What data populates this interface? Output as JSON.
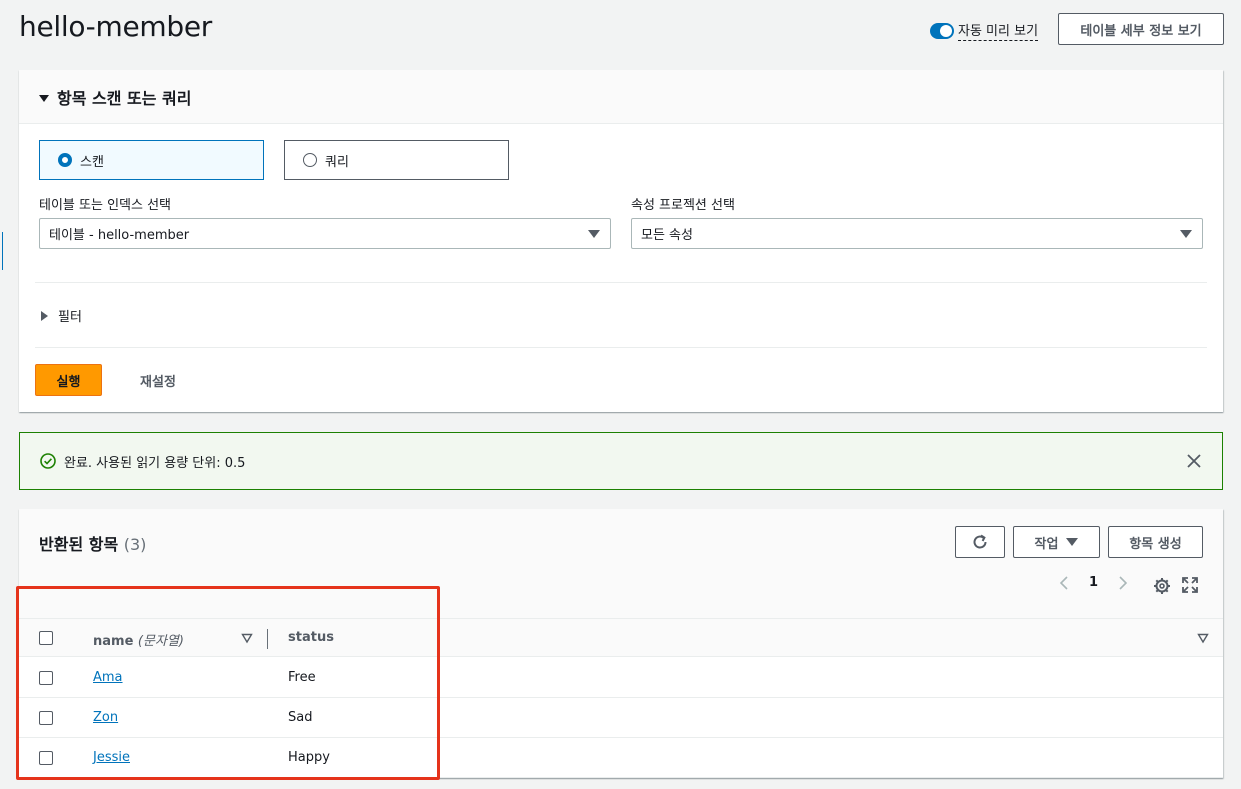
{
  "page": {
    "title": "hello-member",
    "auto_preview_label": "자동 미리 보기",
    "table_details_label": "테이블 세부 정보 보기"
  },
  "scan_panel": {
    "title": "항목 스캔 또는 쿼리",
    "modes": [
      {
        "label": "스캔",
        "selected": true
      },
      {
        "label": "쿼리",
        "selected": false
      }
    ],
    "table_select": {
      "label": "테이블 또는 인덱스 선택",
      "value": "테이블 - hello-member"
    },
    "attr_select": {
      "label": "속성 프로젝션 선택",
      "value": "모든 속성"
    },
    "filter_label": "필터",
    "run_label": "실행",
    "reset_label": "재설정"
  },
  "flash": {
    "message": "완료. 사용된 읽기 용량 단위: 0.5",
    "color": "#1d8102"
  },
  "items_panel": {
    "title": "반환된 항목",
    "count": "(3)",
    "actions_label": "작업",
    "create_label": "항목 생성",
    "page_number": "1",
    "columns": {
      "name": "name",
      "name_type": "(문자열)",
      "status": "status"
    },
    "rows": [
      {
        "name": "Ama",
        "status": "Free"
      },
      {
        "name": "Zon",
        "status": "Sad"
      },
      {
        "name": "Jessie",
        "status": "Happy"
      }
    ]
  },
  "colors": {
    "accent": "#0073bb",
    "primary_button": "#ff9900",
    "highlight": "#e5331b"
  }
}
